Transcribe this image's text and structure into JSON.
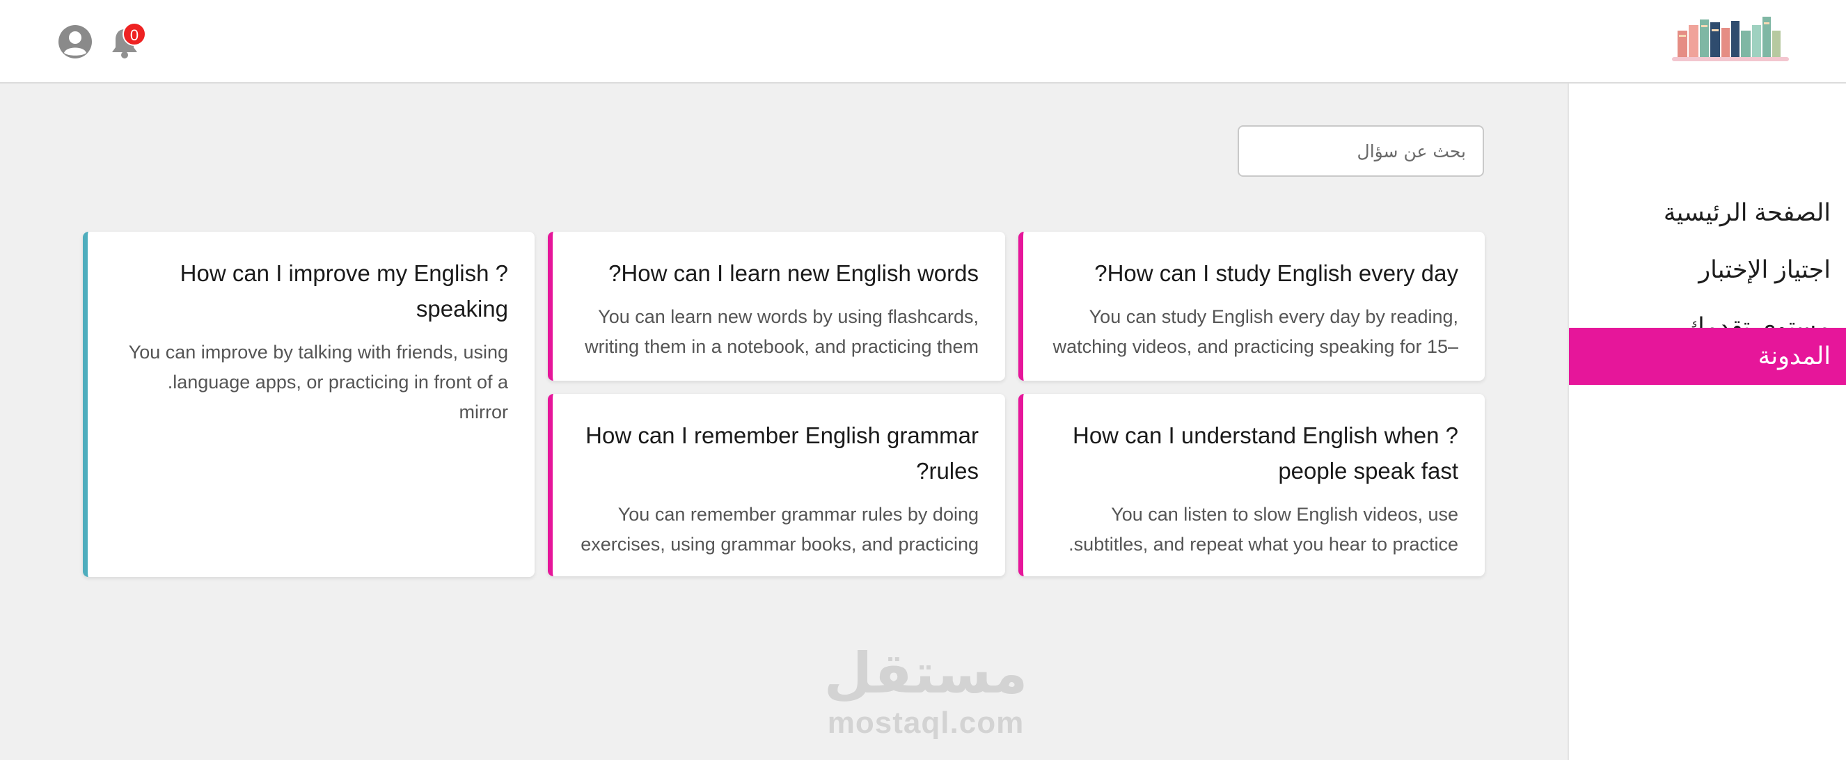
{
  "header": {
    "avatar_icon": "user-circle-icon",
    "bell_icon": "bell-icon",
    "notification_count": "0",
    "logo_icon": "books-logo"
  },
  "sidebar": {
    "items": [
      {
        "label": "الصفحة الرئيسية",
        "active": false
      },
      {
        "label": "اجتياز الإختبار",
        "active": false
      },
      {
        "label": "مستوى تقدمك",
        "active": false
      },
      {
        "label": "المدونة",
        "active": true
      }
    ],
    "active_color": "#e6169a"
  },
  "search": {
    "placeholder": "بحث عن سؤال",
    "value": ""
  },
  "cards": [
    {
      "title": "?How can I study English every day",
      "body": "You can study English every day by reading, watching videos, and practicing speaking for 15–",
      "accent": "#e6169a"
    },
    {
      "title": "?How can I learn new English words",
      "body": "You can learn new words by using flashcards, writing them in a notebook, and practicing them",
      "accent": "#e6169a"
    },
    {
      "title": "How can I improve my English ?speaking",
      "body": "You can improve by talking with friends, using .language apps, or practicing in front of a mirror",
      "accent": "#4eadbd"
    },
    {
      "title": "How can I understand English when ?people speak fast",
      "body": "You can listen to slow English videos, use .subtitles, and repeat what you hear to practice",
      "accent": "#e6169a"
    },
    {
      "title": "How can I remember English grammar ?rules",
      "body": "You can remember grammar rules by doing exercises, using grammar books, and practicing",
      "accent": "#e6169a"
    }
  ],
  "watermark": {
    "arabic": "مستقل",
    "latin": "mostaql.com"
  }
}
